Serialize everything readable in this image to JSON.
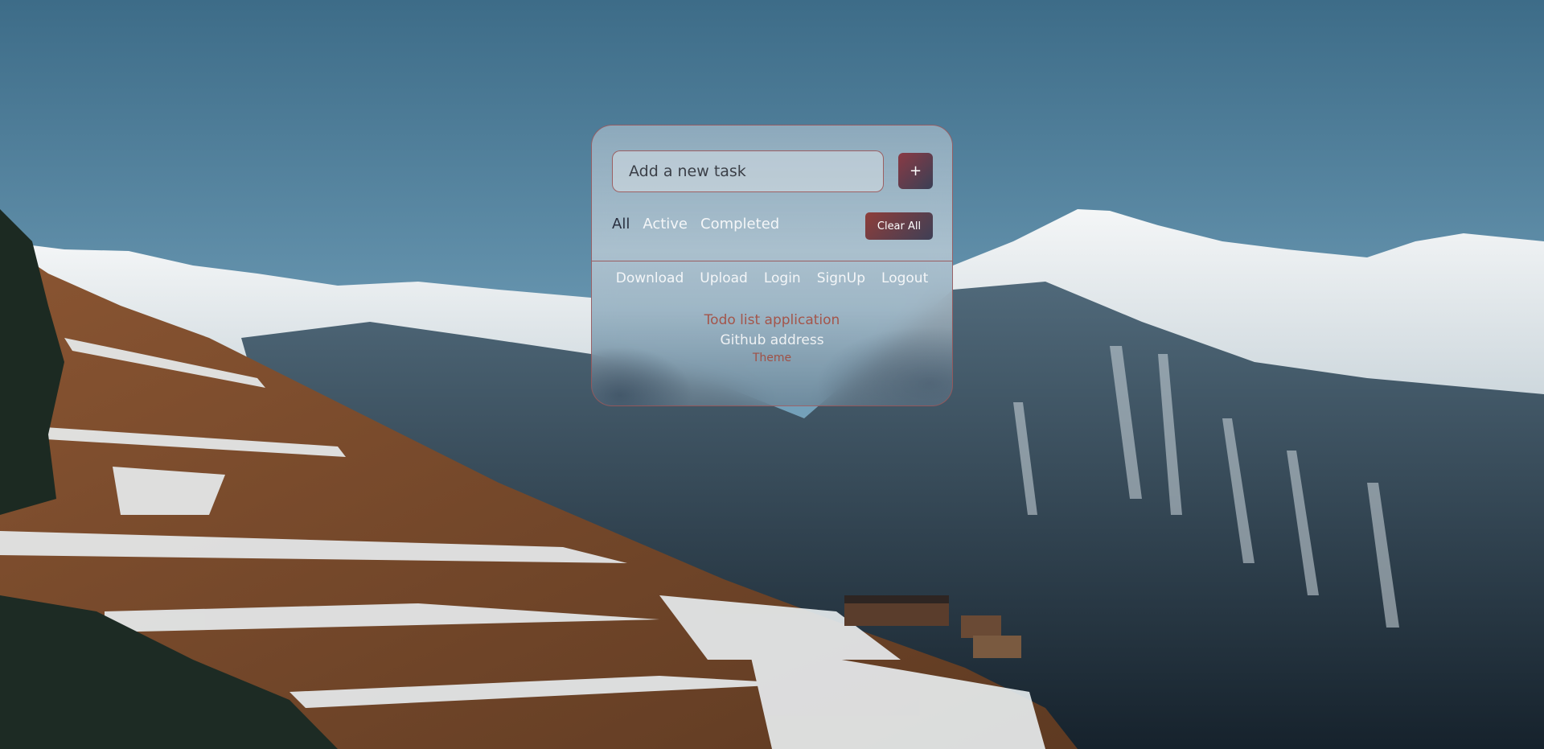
{
  "background": {
    "description_icon": "mountain-landscape"
  },
  "todo": {
    "input": {
      "placeholder": "Add a new task",
      "value": ""
    },
    "add_label": "+",
    "filters": [
      "All",
      "Active",
      "Completed"
    ],
    "active_filter": "All",
    "clear_label": "Clear All"
  },
  "nav": {
    "links": [
      "Download",
      "Upload",
      "Login",
      "SignUp",
      "Logout"
    ]
  },
  "footer": {
    "title": "Todo list application",
    "github": "Github address",
    "theme": "Theme"
  },
  "colors": {
    "accent": "#8a3a44",
    "accent_dark": "#3a3f55",
    "card_border": "#a04b4b",
    "title_text": "#a4554a"
  }
}
